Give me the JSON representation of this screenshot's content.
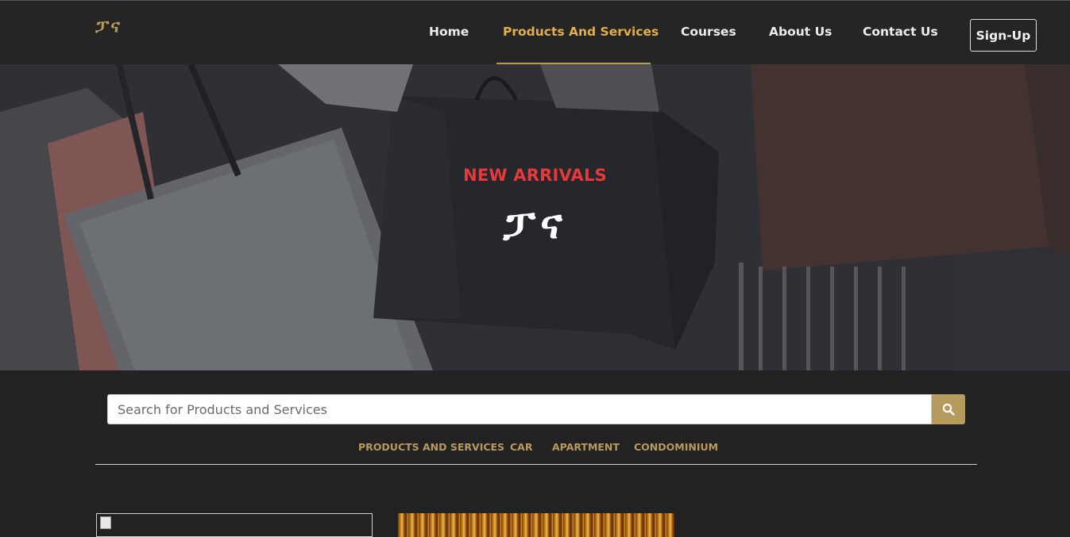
{
  "header": {
    "logo_text": "ፓና",
    "nav": [
      {
        "label": "Home",
        "active": false
      },
      {
        "label": "Products And Services",
        "active": true
      },
      {
        "label": "Courses",
        "active": false
      },
      {
        "label": "About Us",
        "active": false
      },
      {
        "label": "Contact Us",
        "active": false
      }
    ],
    "signup_label": "Sign-Up"
  },
  "hero": {
    "kicker": "NEW ARRIVALS",
    "title": "ፓና"
  },
  "search": {
    "placeholder": "Search for Products and Services",
    "value": "",
    "icon": "search-icon"
  },
  "categories": [
    {
      "label": "PRODUCTS AND SERVICES"
    },
    {
      "label": "CAR"
    },
    {
      "label": "APARTMENT"
    },
    {
      "label": "CONDOMINIUM"
    }
  ],
  "colors": {
    "accent": "#b79a5e",
    "active_nav": "#e1b04a",
    "kicker_red": "#e63939",
    "background": "#222222"
  }
}
